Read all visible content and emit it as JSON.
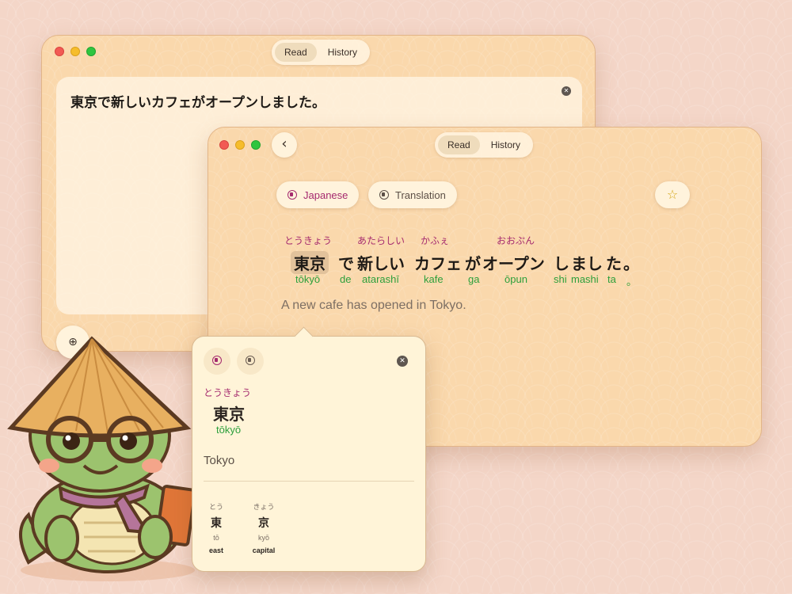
{
  "back_window": {
    "segmented": [
      {
        "label": "Read",
        "active": true
      },
      {
        "label": "History",
        "active": false
      }
    ],
    "input_text": "東京で新しいカフェがオープンしました。",
    "clear_icon": "close-icon",
    "globe_icon": "globe-icon"
  },
  "front_window": {
    "segmented": [
      {
        "label": "Read",
        "active": true
      },
      {
        "label": "History",
        "active": false
      }
    ],
    "back_icon": "chevron-left-icon",
    "japanese_button": {
      "label": "Japanese",
      "icon": "speaker-icon",
      "color": "#a52a6e"
    },
    "translation_button": {
      "label": "Translation",
      "icon": "speaker-icon",
      "color": "#5b4f46"
    },
    "star_icon": "star-icon",
    "tokens": [
      {
        "furigana": "とうきょう",
        "text": "東京",
        "romaji": "tōkyō"
      },
      {
        "furigana": "",
        "text": "で",
        "romaji": "de"
      },
      {
        "furigana": "あたらしい",
        "text": "新しい",
        "romaji": "atarashī"
      },
      {
        "furigana": "かふぇ",
        "text": "カフェ",
        "romaji": "kafe"
      },
      {
        "furigana": "",
        "text": "が",
        "romaji": "ga"
      },
      {
        "furigana": "おおぷん",
        "text": "オープン",
        "romaji": "ōpun"
      },
      {
        "furigana": "",
        "text": "し",
        "romaji": "shi"
      },
      {
        "furigana": "",
        "text": "まし",
        "romaji": "mashi"
      },
      {
        "furigana": "",
        "text": "た",
        "romaji": "ta"
      },
      {
        "furigana": "",
        "text": "。",
        "romaji": "。"
      }
    ],
    "translation": "A new cafe has opened in Tokyo."
  },
  "popover": {
    "furigana": "とうきょう",
    "word": "東京",
    "romaji": "tōkyō",
    "meaning": "Tokyo",
    "characters": [
      {
        "furigana": "とう",
        "kanji": "東",
        "romaji": "tō",
        "meaning": "east"
      },
      {
        "furigana": "きょう",
        "kanji": "京",
        "romaji": "kyō",
        "meaning": "capital"
      }
    ],
    "colors": {
      "furigana": "#a52a6e",
      "romaji": "#2c9f3b"
    }
  }
}
